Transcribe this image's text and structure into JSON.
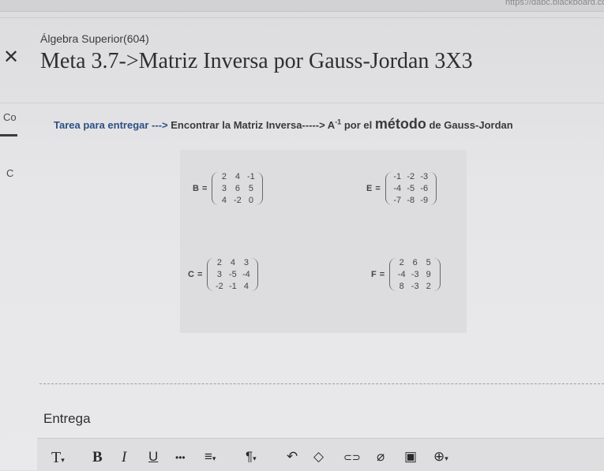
{
  "browser": {
    "url_text": "https://dabc.blackboard.com"
  },
  "header": {
    "course": "Álgebra Superior(604)",
    "title": "Meta 3.7->Matriz Inversa por Gauss-Jordan 3X3",
    "close_icon": "close-icon"
  },
  "sidebar_cut": {
    "text_1": "Co",
    "text_2": "C"
  },
  "task": {
    "part1": "Tarea para entregar --->",
    "part2": "Encontrar la Matriz Inversa----->",
    "symbol": "A",
    "exponent": "-1",
    "part3": "por el",
    "part4": "método",
    "part5": "de Gauss-Jordan"
  },
  "matrices": [
    {
      "name": "B",
      "eq": "=",
      "rows": [
        [
          "2",
          "4",
          "-1"
        ],
        [
          "3",
          "6",
          "5"
        ],
        [
          "4",
          "-2",
          "0"
        ]
      ]
    },
    {
      "name": "E",
      "eq": "=",
      "rows": [
        [
          "-1",
          "-2",
          "-3"
        ],
        [
          "-4",
          "-5",
          "-6"
        ],
        [
          "-7",
          "-8",
          "-9"
        ]
      ]
    },
    {
      "name": "C",
      "eq": "=",
      "rows": [
        [
          "2",
          "4",
          "3"
        ],
        [
          "3",
          "-5",
          "-4"
        ],
        [
          "-2",
          "-1",
          "4"
        ]
      ]
    },
    {
      "name": "F",
      "eq": "=",
      "rows": [
        [
          "2",
          "6",
          "5"
        ],
        [
          "-4",
          "-3",
          "9"
        ],
        [
          "8",
          "-3",
          "2"
        ]
      ]
    }
  ],
  "submission": {
    "label": "Entrega"
  },
  "toolbar": {
    "text_style": "T",
    "bold": "B",
    "italic": "I",
    "underline": "U",
    "more": "•••",
    "align": "≡",
    "paragraph": "¶",
    "undo": "↶",
    "clear": "◇",
    "link": "⊂⊃",
    "attach": "⌀",
    "image": "▣",
    "add": "⊕"
  }
}
